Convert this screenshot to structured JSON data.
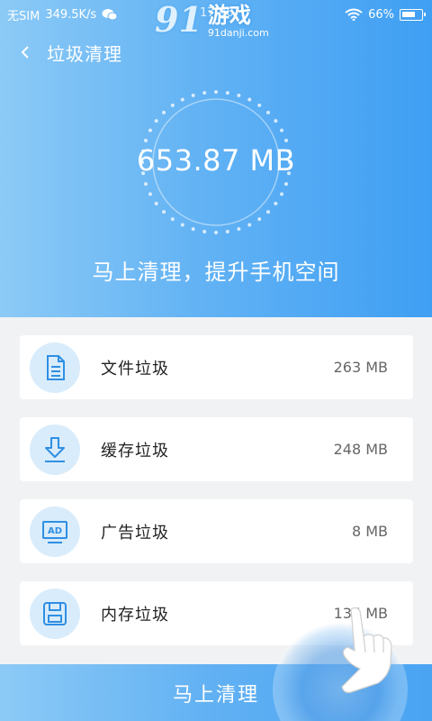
{
  "status_bar": {
    "carrier": "无SIM",
    "net_speed": "349.5K/s",
    "battery": "66%"
  },
  "watermark": {
    "logo": "91",
    "title": "游戏",
    "url": "91danji.com",
    "time": "17:36"
  },
  "nav": {
    "title": "垃圾清理"
  },
  "hero": {
    "total_size": "653.87 MB",
    "slogan": "马上清理，提升手机空间"
  },
  "items": [
    {
      "label": "文件垃圾",
      "size": "263 MB",
      "icon": "file-icon"
    },
    {
      "label": "缓存垃圾",
      "size": "248 MB",
      "icon": "download-icon"
    },
    {
      "label": "广告垃圾",
      "size": "8 MB",
      "icon": "ad-icon"
    },
    {
      "label": "内存垃圾",
      "size": "135 MB",
      "icon": "save-icon"
    }
  ],
  "action": {
    "clean_label": "马上清理"
  },
  "colors": {
    "accent": "#4aa4f2",
    "icon_bg": "#d9ecfb",
    "icon_stroke": "#2f8fe3"
  }
}
